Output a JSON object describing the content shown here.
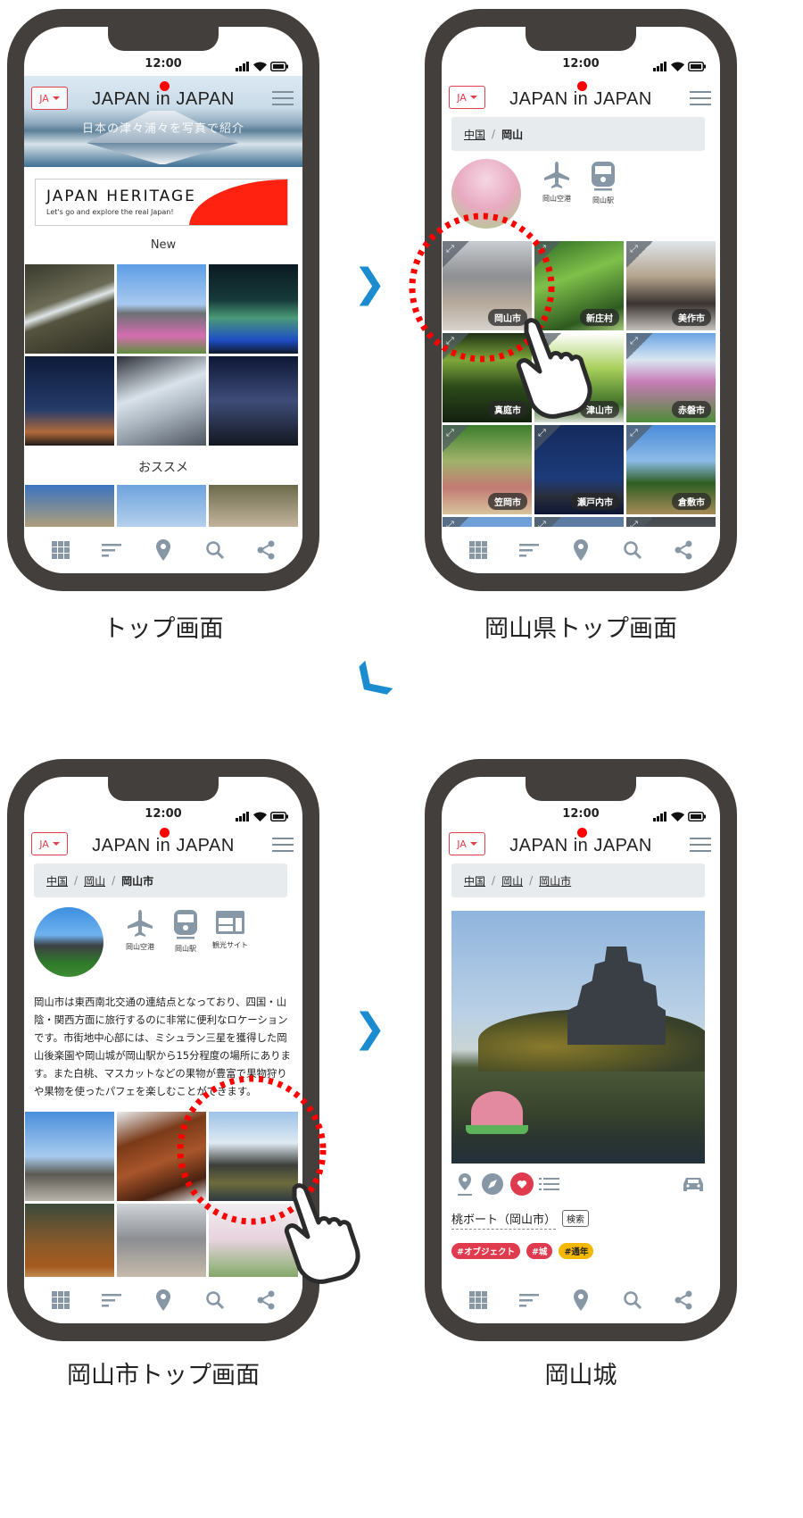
{
  "common": {
    "time": "12:00",
    "lang": "JA",
    "logo": "JAPAN in JAPAN",
    "nav": [
      "grid-icon",
      "sort-icon",
      "map-pin-icon",
      "search-icon",
      "share-icon"
    ],
    "icon_color": "#8797a5"
  },
  "colors": {
    "accent_red": "#e0404e",
    "arrow_blue": "#1a8ccf",
    "bezel": "#433f3d",
    "tag_yellow": "#f5b800"
  },
  "screen1": {
    "caption": "トップ画面",
    "hero_subtitle": "日本の津々浦々を写真で紹介",
    "banner_title": "JAPAN HERITAGE",
    "banner_subtitle": "Let's go and explore the real Japan!",
    "section_new": "New",
    "section_recommend": "おススメ"
  },
  "screen2": {
    "caption": "岡山県トップ画面",
    "breadcrumb": [
      "中国",
      "岡山"
    ],
    "quick_links": [
      "岡山空港",
      "岡山駅"
    ],
    "tiles": [
      "岡山市",
      "新庄村",
      "美作市",
      "真庭市",
      "津山市",
      "赤磐市",
      "笠岡市",
      "瀬戸内市",
      "倉敷市"
    ]
  },
  "screen3": {
    "caption": "岡山市トップ画面",
    "breadcrumb": [
      "中国",
      "岡山",
      "岡山市"
    ],
    "quick_links": [
      "岡山空港",
      "岡山駅",
      "観光サイト"
    ],
    "description": "岡山市は東西南北交通の連結点となっており、四国・山陰・関西方面に旅行するのに非常に便利なロケーションです。市街地中心部には、ミシュラン三星を獲得した岡山後楽園や岡山城が岡山駅から15分程度の場所にあります。また白桃、マスカットなどの果物が豊富で果物狩りや果物を使ったパフェを楽しむことができます。"
  },
  "screen4": {
    "caption": "岡山城",
    "breadcrumb": [
      "中国",
      "岡山",
      "岡山市"
    ],
    "spot_title": "桃ボート（岡山市）",
    "search_label": "検索",
    "tags": [
      {
        "label": "#オブジェクト",
        "color": "#e03a4e"
      },
      {
        "label": "#城",
        "color": "#e03a4e"
      },
      {
        "label": "#通年",
        "color": "#f5b800"
      }
    ]
  }
}
